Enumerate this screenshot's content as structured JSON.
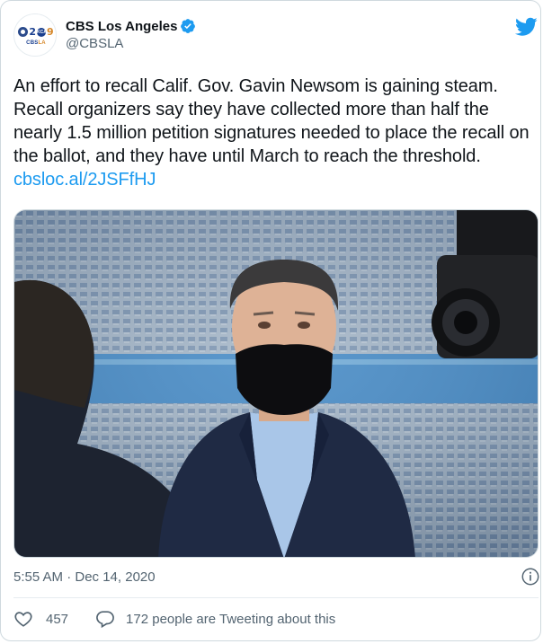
{
  "account": {
    "display_name": "CBS Los Angeles",
    "handle": "@CBSLA",
    "verified": true,
    "avatar_logo": {
      "digit_left": "2",
      "badge": "KCAL",
      "digit_right": "9",
      "caption_cbs": "CBS",
      "caption_la": "LA"
    }
  },
  "tweet": {
    "text": "An effort to recall Calif. Gov. Gavin Newsom is gaining steam. Recall organizers say they have collected more than half the nearly 1.5 million petition signatures needed to place the recall on the ballot, and they have until March to reach the threshold.",
    "link": "cbsloc.al/2JSFfHJ",
    "timestamp": "5:55 AM · Dec 14, 2020"
  },
  "engagement": {
    "likes": "457",
    "reply_text": "172 people are Tweeting about this"
  },
  "icons": {
    "platform": "twitter-bird-icon",
    "verified": "verified-badge-icon",
    "info": "info-icon",
    "like": "heart-icon",
    "reply": "speech-bubble-icon"
  },
  "colors": {
    "brand_blue": "#1d9bf0",
    "text_primary": "#0f1419",
    "text_secondary": "#536471"
  }
}
